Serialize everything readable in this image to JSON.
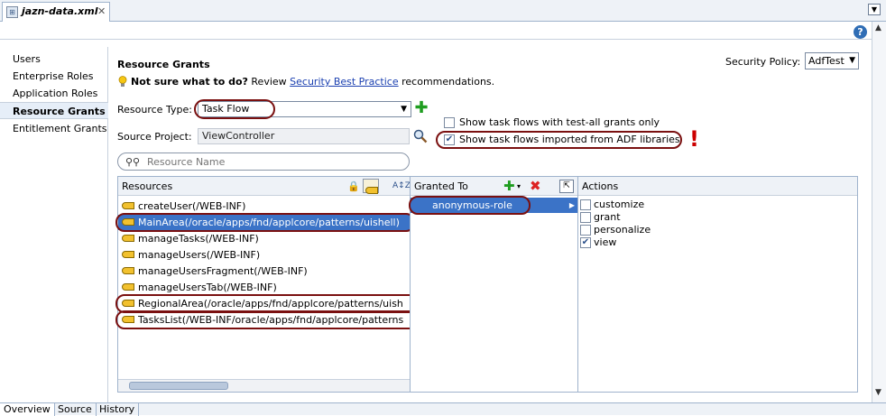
{
  "doc_tab": {
    "title": "jazn-data.xml",
    "close": "✕"
  },
  "help": "?",
  "left_nav": [
    "Users",
    "Enterprise Roles",
    "Application Roles",
    "Resource Grants",
    "Entitlement Grants"
  ],
  "section_title": "Resource Grants",
  "hint": {
    "bold": "Not sure what to do?",
    "pre": " Review ",
    "link": "Security Best Practice",
    "post": " recommendations."
  },
  "security_policy": {
    "label": "Security Policy:",
    "value": "AdfTest"
  },
  "resource_type": {
    "label": "Resource Type:",
    "value": "Task Flow"
  },
  "source_project": {
    "label": "Source Project:",
    "value": "ViewController"
  },
  "checkboxes": [
    {
      "label": "Show task flows with test-all grants only",
      "checked": false
    },
    {
      "label": "Show task flows imported from ADF libraries",
      "checked": true
    }
  ],
  "exclamation": "!",
  "search_placeholder": "Resource Name",
  "resources": {
    "header": "Resources",
    "sort_icon": "A↕Z",
    "items": [
      "createUser(/WEB-INF)",
      "MainArea(/oracle/apps/fnd/applcore/patterns/uishell)",
      "manageTasks(/WEB-INF)",
      "manageUsers(/WEB-INF)",
      "manageUsersFragment(/WEB-INF)",
      "manageUsersTab(/WEB-INF)",
      "RegionalArea(/oracle/apps/fnd/applcore/patterns/uish",
      "TasksList(/WEB-INF/oracle/apps/fnd/applcore/patterns"
    ]
  },
  "granted_to": {
    "header": "Granted To",
    "items": [
      "anonymous-role"
    ]
  },
  "actions": {
    "header": "Actions",
    "items": [
      {
        "label": "customize",
        "checked": false
      },
      {
        "label": "grant",
        "checked": false
      },
      {
        "label": "personalize",
        "checked": false
      },
      {
        "label": "view",
        "checked": true
      }
    ]
  },
  "bottom_tabs": [
    "Overview",
    "Source",
    "History"
  ]
}
